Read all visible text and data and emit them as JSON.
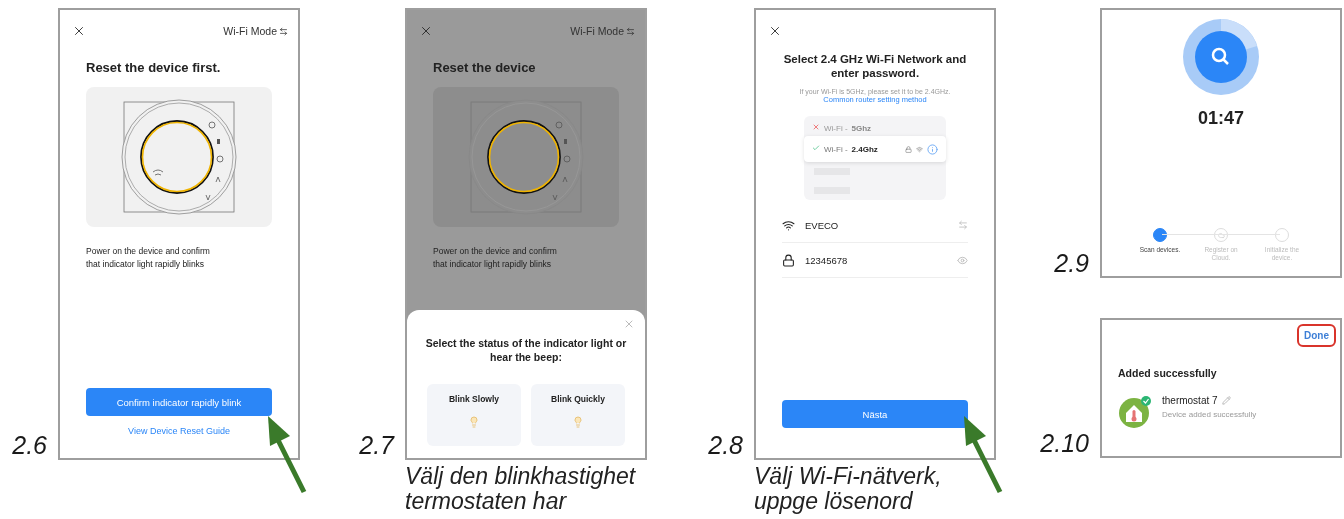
{
  "columns": [
    {
      "figures": [
        {
          "kind": "reset",
          "number": "2.6",
          "mode_link": "Wi-Fi Mode",
          "title": "Reset the device first.",
          "instruction": "Power on the device and confirm that indicator light rapidly blinks",
          "dimmed": false,
          "button": "Confirm indicator rapidly blink",
          "link": "View Device Reset Guide",
          "arrow": true
        }
      ]
    },
    {
      "figures": [
        {
          "kind": "reset",
          "number": "2.7",
          "mode_link": "Wi-Fi Mode",
          "title": "Reset the device",
          "instruction": "Power on the device and confirm that indicator light rapidly blinks",
          "dimmed": true,
          "sheet": {
            "title": "Select the status of the indicator light or hear the beep:",
            "options": [
              "Blink Slowly",
              "Blink Quickly"
            ]
          }
        }
      ],
      "caption": "Välj den blinkhastighet termostaten har"
    },
    {
      "figures": [
        {
          "kind": "wifi",
          "number": "2.8",
          "title": "Select 2.4 GHz Wi-Fi Network and enter password.",
          "note": "If your Wi-Fi is 5GHz, please set it to be 2.4GHz.",
          "note_link": "Common router setting method",
          "networks": [
            {
              "prefix": "Wi-Fi - ",
              "band": "5Ghz",
              "selected": false
            },
            {
              "prefix": "Wi-Fi - ",
              "band": "2.4Ghz",
              "selected": true
            }
          ],
          "ssid": "EVECO",
          "password": "12345678",
          "button": "Nästa",
          "arrow": true
        }
      ],
      "caption": "Välj Wi-Fi-nätverk, uppge lösenord"
    },
    {
      "figures": [
        {
          "kind": "scan",
          "number": "2.9",
          "timer": "01:47",
          "steps": [
            {
              "label": "Scan devices.",
              "selected": true
            },
            {
              "label": "Register on Cloud.",
              "selected": false
            },
            {
              "label": "Initialize the device.",
              "selected": false
            }
          ]
        },
        {
          "kind": "done",
          "number": "2.10",
          "done": "Done",
          "title": "Added successfully",
          "device": "thermostat 7",
          "status": "Device added successfully"
        }
      ]
    }
  ]
}
